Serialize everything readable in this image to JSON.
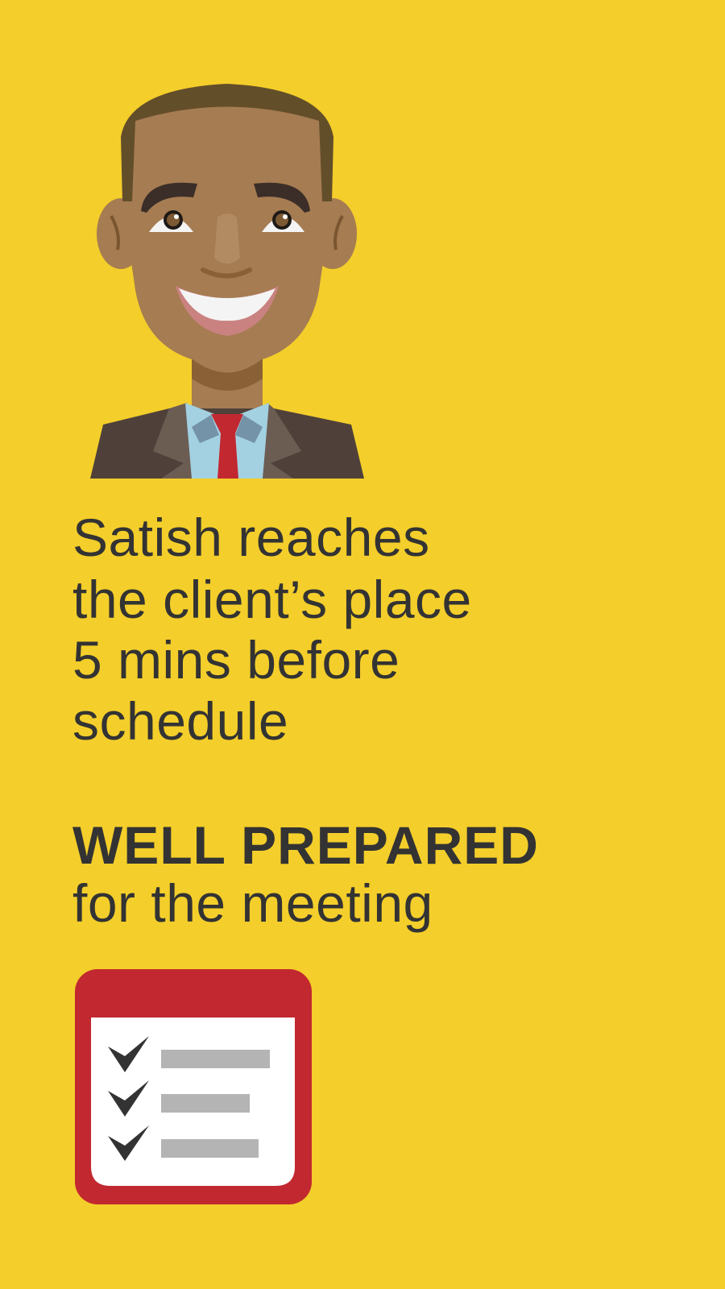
{
  "headline": {
    "lines": [
      "Satish reaches",
      "the client’s place",
      "5 mins before",
      "schedule"
    ]
  },
  "emphasis": {
    "strong": "WELL PREPARED",
    "rest": "for the meeting"
  },
  "illustrations": {
    "character": "smiling-businessman-avatar",
    "icon": "checklist-icon"
  },
  "colors": {
    "background": "#F4CE2A",
    "text": "#333333",
    "checklist_frame": "#C22830",
    "checklist_bars": "#B4B4B4",
    "tie": "#C22830",
    "shirt": "#A3D1E1",
    "suit": "#4F413A"
  }
}
